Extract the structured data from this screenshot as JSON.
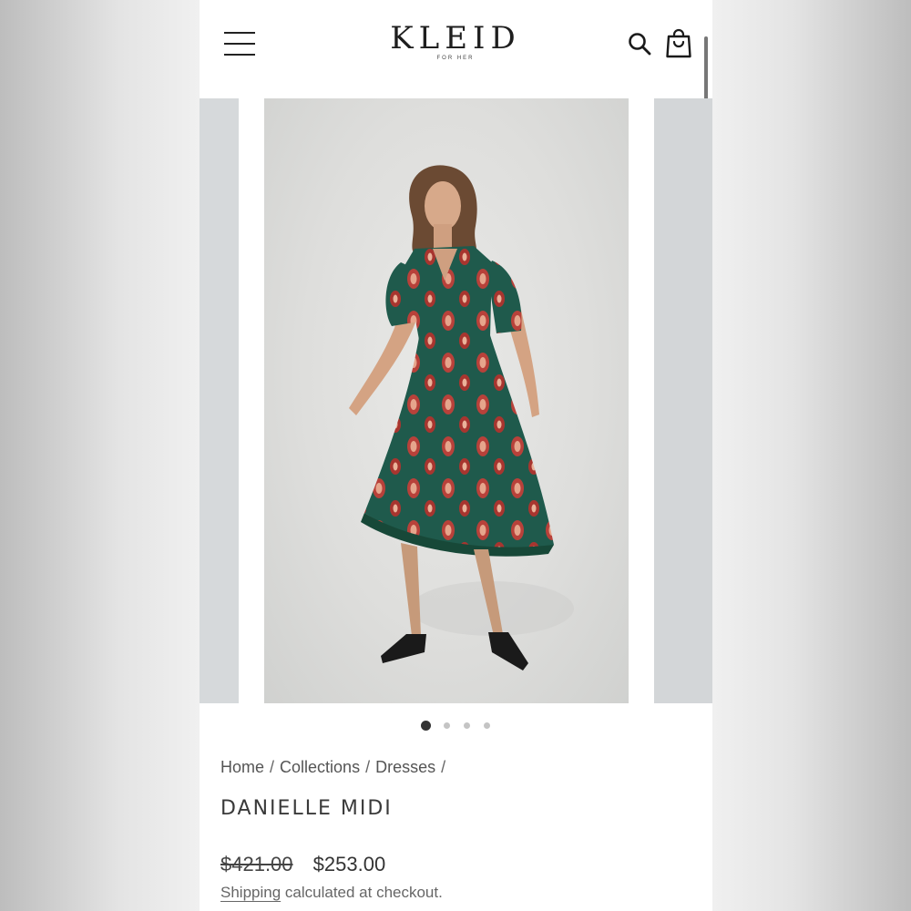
{
  "header": {
    "brand_name": "KLEID",
    "brand_sub": "FOR HER",
    "menu_icon": "hamburger-menu-icon",
    "search_icon": "search-icon",
    "cart_icon": "shopping-bag-icon"
  },
  "gallery": {
    "image_alt": "Model wearing the Danielle Midi dress",
    "zoom_icon": "zoom-magnifier-icon",
    "slide_count": 4,
    "active_slide": 1
  },
  "breadcrumb": {
    "items": [
      "Home",
      "Collections",
      "Dresses"
    ],
    "separator": "/"
  },
  "product": {
    "title": "DANIELLE MIDI",
    "old_price": "$421.00",
    "new_price": "$253.00",
    "shipping_link": "Shipping",
    "shipping_rest": " calculated at checkout."
  },
  "colors": {
    "dress_green": "#1f5a4c",
    "print_red": "#b8413a",
    "text_dark": "#333333"
  }
}
